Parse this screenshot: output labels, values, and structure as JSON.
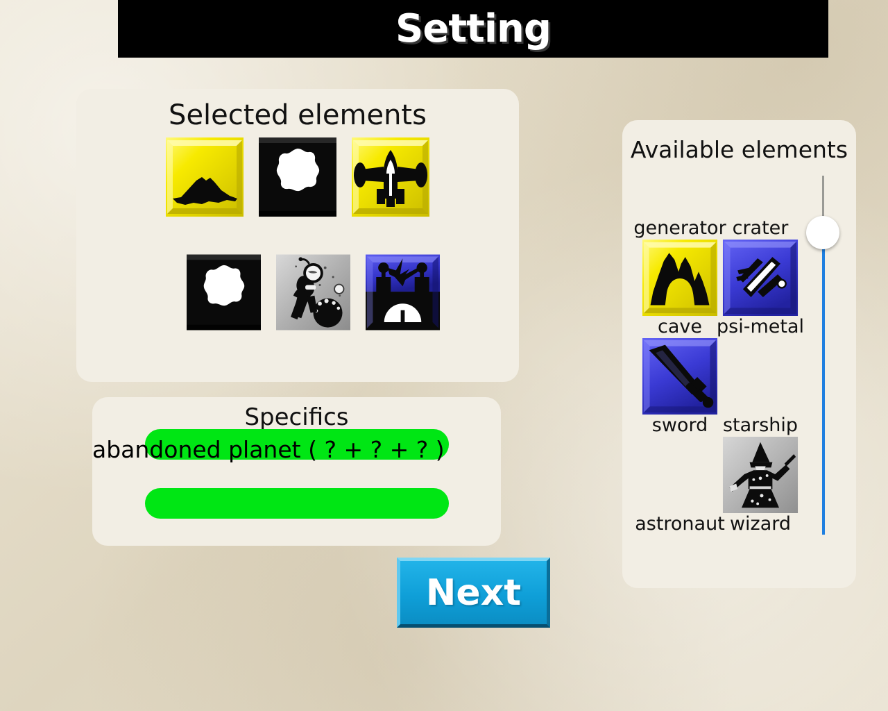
{
  "header": {
    "title": "Setting"
  },
  "selected": {
    "heading": "Selected elements",
    "row1": [
      {
        "name": "mountain",
        "icon": "mountain-icon"
      },
      {
        "name": "crater",
        "icon": "crater-icon"
      },
      {
        "name": "starship",
        "icon": "starship-icon"
      }
    ],
    "row2": [
      {
        "name": "crater",
        "icon": "crater-icon"
      },
      {
        "name": "astronaut",
        "icon": "astronaut-icon"
      },
      {
        "name": "generator",
        "icon": "generator-icon"
      }
    ]
  },
  "specifics": {
    "heading": "Specifics",
    "pill_color": "#00e614",
    "field1_value": "abandoned planet ( ? + ? + ? )",
    "field2_value": ""
  },
  "next_button": {
    "label": "Next",
    "color": "#0f9fd8"
  },
  "available": {
    "heading": "Available elements",
    "grid": [
      {
        "kind": "label",
        "text": "generator"
      },
      {
        "kind": "label",
        "text": "crater"
      },
      {
        "kind": "icon",
        "icon": "cave-icon",
        "name": "cave"
      },
      {
        "kind": "icon",
        "icon": "psi-metal-icon",
        "name": "psi-metal"
      },
      {
        "kind": "label",
        "text": "cave"
      },
      {
        "kind": "label",
        "text": "psi-metal"
      },
      {
        "kind": "icon",
        "icon": "sword-icon",
        "name": "sword"
      },
      {
        "kind": "empty"
      },
      {
        "kind": "label",
        "text": "sword"
      },
      {
        "kind": "label",
        "text": "starship"
      },
      {
        "kind": "empty"
      },
      {
        "kind": "icon",
        "icon": "wizard-icon",
        "name": "wizard"
      },
      {
        "kind": "label",
        "text": "astronaut"
      },
      {
        "kind": "label",
        "text": "wizard"
      }
    ]
  },
  "scrollbar": {
    "upper_track_color": "#9a9a95",
    "lower_track_color": "#1f7fe0",
    "thumb_color": "#ffffff"
  },
  "colors": {
    "page_background": "#e3dbc8",
    "panel_background": "#f2eee4",
    "banner_background": "#000000",
    "tile_yellow": "#f5e800",
    "tile_blue": "#3a3ad0",
    "tile_black": "#0a0a0a",
    "tile_gray": "#b3b3b3"
  }
}
